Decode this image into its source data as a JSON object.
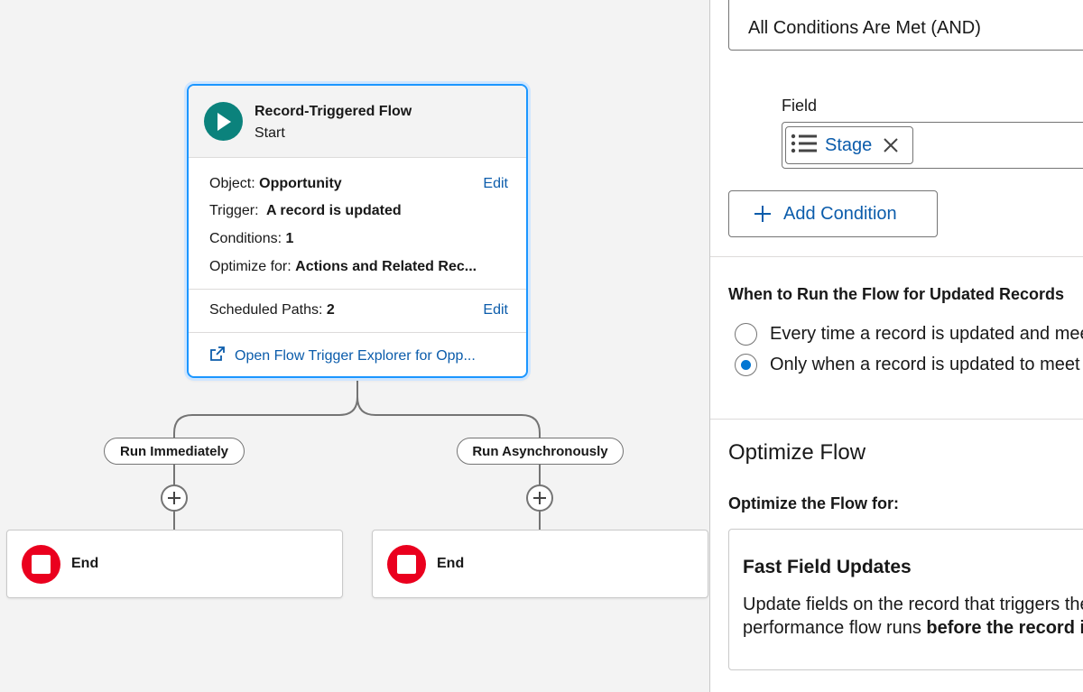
{
  "canvas": {
    "start": {
      "title": "Record-Triggered Flow",
      "subtitle": "Start",
      "object_label": "Object:",
      "object_value": "Opportunity",
      "trigger_label": "Trigger:",
      "trigger_value": "A record is updated",
      "conditions_label": "Conditions:",
      "conditions_value": "1",
      "optimize_label": "Optimize for:",
      "optimize_value": "Actions and Related Rec...",
      "edit_label": "Edit",
      "scheduled_label": "Scheduled Paths:",
      "scheduled_value": "2",
      "explorer_link": "Open Flow Trigger Explorer for Opp..."
    },
    "paths": [
      {
        "label": "Run Immediately",
        "end_label": "End"
      },
      {
        "label": "Run Asynchronously",
        "end_label": "End"
      }
    ]
  },
  "panel": {
    "condition_logic": "All Conditions Are Met (AND)",
    "field_label": "Field",
    "field_value": "Stage",
    "add_condition_label": "Add Condition",
    "run_title": "When to Run the Flow for Updated Records",
    "run_options": [
      {
        "label": "Every time a record is updated and meets the condition requirements",
        "checked": false
      },
      {
        "label": "Only when a record is updated to meet the condition requirements",
        "checked": true
      }
    ],
    "optimize_title": "Optimize Flow",
    "optimize_subtitle": "Optimize the Flow for:",
    "option_card": {
      "title": "Fast Field Updates",
      "desc_line1": "Update fields on the record that triggers the flow to run. This high-",
      "desc_line2_prefix": "performance flow runs ",
      "desc_line2_bold": "before the record is saved to the database."
    }
  },
  "colors": {
    "accent": "#0b5cab",
    "start_badge": "#0b827c",
    "end_badge": "#ea001e",
    "selection": "#1b96ff",
    "radio_checked": "#0176d3"
  },
  "icons": [
    "play-icon",
    "external-link-icon",
    "plus-icon",
    "stop-icon",
    "picklist-icon",
    "close-icon"
  ]
}
